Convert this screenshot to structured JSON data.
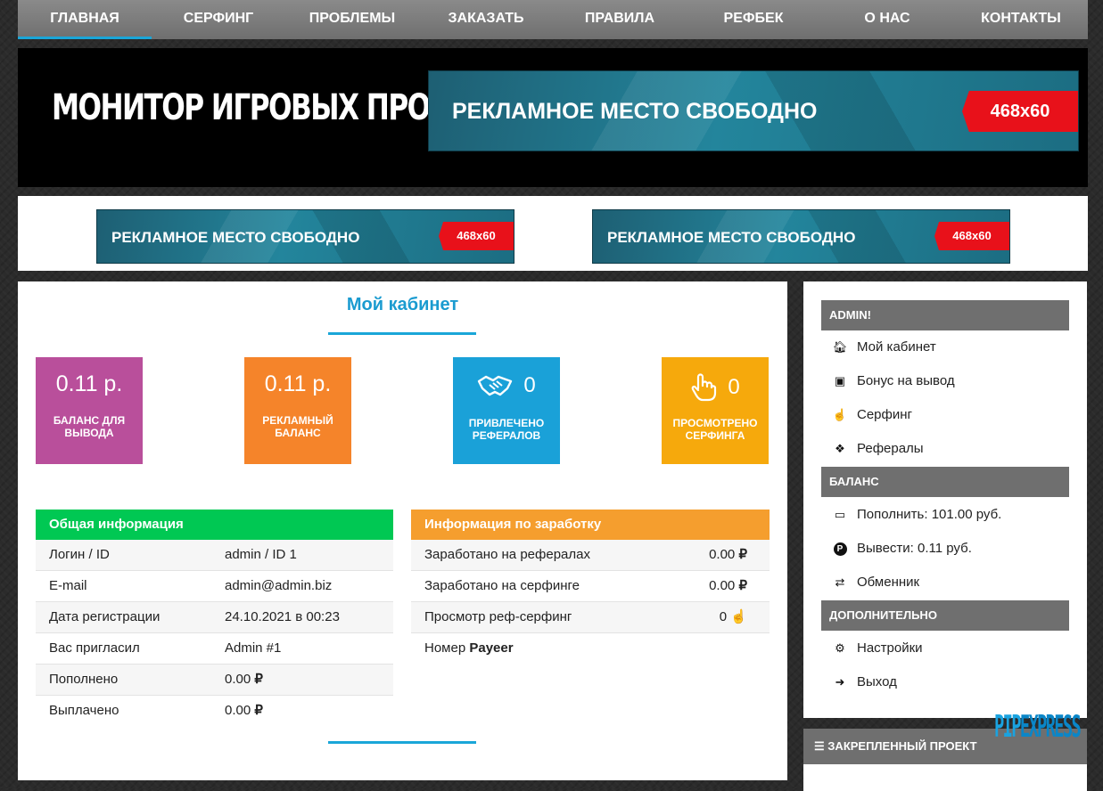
{
  "nav": {
    "items": [
      {
        "label": "ГЛАВНАЯ"
      },
      {
        "label": "СЕРФИНГ"
      },
      {
        "label": "ПРОБЛЕМЫ"
      },
      {
        "label": "ЗАКАЗАТЬ"
      },
      {
        "label": "ПРАВИЛА"
      },
      {
        "label": "РЕФБЕК"
      },
      {
        "label": "О НАС"
      },
      {
        "label": "КОНТАКТЫ"
      }
    ]
  },
  "header": {
    "site_title": "МОНИТОР ИГРОВЫХ ПРОЕКТОВ",
    "ad_main": {
      "text": "РЕКЛАМНОЕ  МЕСТО СВОБОДНО",
      "size": "468x60"
    }
  },
  "banners": [
    {
      "text": "РЕКЛАМНОЕ  МЕСТО СВОБОДНО",
      "size": "468x60"
    },
    {
      "text": "РЕКЛАМНОЕ  МЕСТО СВОБОДНО",
      "size": "468x60"
    }
  ],
  "cabinet": {
    "title": "Мой кабинет",
    "tiles": [
      {
        "value": "0.11 р.",
        "label": "БАЛАНС ДЛЯ ВЫВОДА",
        "color": "#b94f9b"
      },
      {
        "value": "0.11 р.",
        "label": "РЕКЛАМНЫЙ БАЛАНС",
        "color": "#f5842a"
      },
      {
        "value": "0",
        "icon": "handshake-icon",
        "label": "ПРИВЛЕЧЕНО РЕФЕРАЛОВ",
        "color": "#1aa1d8"
      },
      {
        "value": "0",
        "icon": "hand-pointer-icon",
        "label": "ПРОСМОТРЕНО СЕРФИНГА",
        "color": "#f6a90c"
      }
    ],
    "general": {
      "title": "Общая информация",
      "color": "#00c853",
      "rows": [
        {
          "k": "Логин / ID",
          "v": "admin / ID 1"
        },
        {
          "k": "E-mail",
          "v": "admin@admin.biz"
        },
        {
          "k": "Дата регистрации",
          "v": "24.10.2021 в 00:23"
        },
        {
          "k": "Вас пригласил",
          "v": "Admin #1"
        },
        {
          "k": "Пополнено",
          "v": "0.00",
          "icon": "ruble-icon"
        },
        {
          "k": "Выплачено",
          "v": "0.00",
          "icon": "ruble-icon"
        }
      ]
    },
    "earnings": {
      "title": "Информация по заработку",
      "color": "#f59e2e",
      "rows": [
        {
          "k": "Заработано на рефералах",
          "v": "0.00",
          "icon": "ruble-icon"
        },
        {
          "k": "Заработано на серфинге",
          "v": "0.00",
          "icon": "ruble-icon"
        },
        {
          "k": "Просмотр реф-серфинг",
          "v": "0",
          "icon": "hand-pointer-icon"
        }
      ],
      "payeer": {
        "prefix": "Номер",
        "name": "Payeer"
      }
    }
  },
  "sidebar": {
    "sections": [
      {
        "title": "ADMIN!",
        "items": [
          {
            "label": "Мой кабинет",
            "icon": "home-icon"
          },
          {
            "label": "Бонус на вывод",
            "icon": "gift-icon"
          },
          {
            "label": "Серфинг",
            "icon": "hand-pointer-icon"
          },
          {
            "label": "Рефералы",
            "icon": "handshake-icon"
          }
        ]
      },
      {
        "title": "БАЛАНС",
        "items": [
          {
            "label": "Пополнить: 101.00 руб.",
            "icon": "credit-card-icon"
          },
          {
            "label": "Вывести: 0.11 руб.",
            "icon": "payeer-icon"
          },
          {
            "label": "Обменник",
            "icon": "retweet-icon"
          }
        ]
      },
      {
        "title": "ДОПОЛНИТЕЛЬНО",
        "items": [
          {
            "label": "Настройки",
            "icon": "cog-icon"
          },
          {
            "label": "Выход",
            "icon": "sign-out-icon"
          }
        ]
      }
    ],
    "fixed_project": {
      "title": "ЗАКРЕПЛЕННЫЙ ПРОЕКТ",
      "icon": "bars-icon"
    }
  },
  "watermark": {
    "part1": "PIP",
    "part2": "EXPRESS"
  }
}
